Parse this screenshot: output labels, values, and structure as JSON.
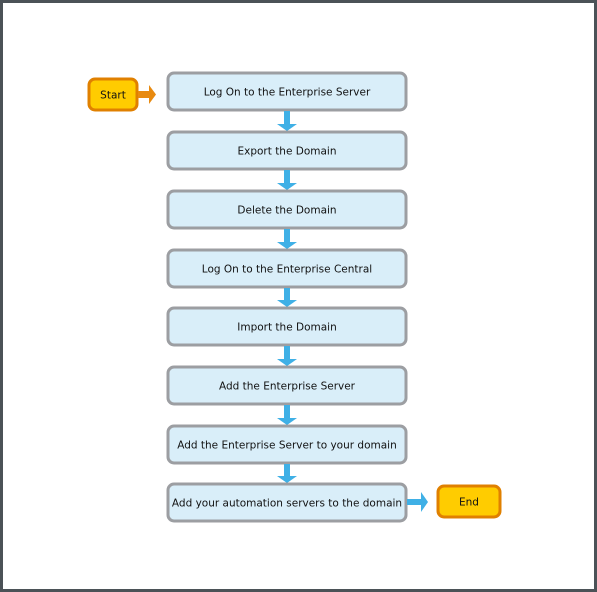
{
  "start_label": "Start",
  "end_label": "End",
  "steps": [
    "Log On to the Enterprise Server",
    "Export the Domain",
    "Delete the Domain",
    "Log On to the Enterprise Central",
    "Import the Domain",
    "Add the Enterprise Server",
    "Add the Enterprise Server to your domain",
    "Add your automation servers to the domain"
  ],
  "colors": {
    "step_fill": "#d9eef9",
    "step_border": "#9c9ea2",
    "terminal_fill": "#ffcc00",
    "terminal_border": "#e08000",
    "start_arrow": "#e88a10",
    "flow_arrow": "#3fb0e6"
  }
}
